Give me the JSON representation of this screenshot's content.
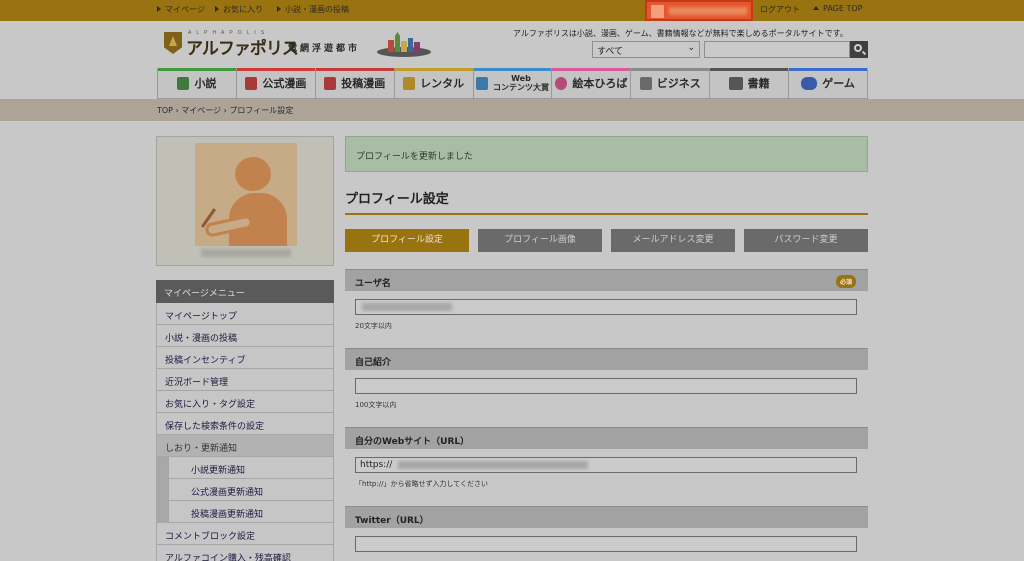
{
  "topbar": {
    "links": [
      "マイページ",
      "お気に入り",
      "小説・漫画の投稿"
    ],
    "logout": "ログアウト",
    "pagetop": "PAGE TOP"
  },
  "header": {
    "logo_sub": "ALPHAPOLIS",
    "logo_main": "アルファポリス",
    "logo_city": "電網浮遊都市",
    "tagline": "アルファポリスは小説、漫画、ゲーム、書籍情報などが無料で楽しめるポータルサイトです。",
    "search_scope": "すべて"
  },
  "nav": [
    {
      "label": "小説",
      "color": "#3d9a3d"
    },
    {
      "label": "公式漫画",
      "color": "#d03a3a"
    },
    {
      "label": "投稿漫画",
      "color": "#c83a3a"
    },
    {
      "label": "レンタル",
      "color": "#c29b2a"
    },
    {
      "label_line1": "Web",
      "label_line2": "コンテンツ大賞",
      "color": "#3a8ccc"
    },
    {
      "label": "絵本ひろば",
      "color": "#d85a9a"
    },
    {
      "label": "ビジネス",
      "color": "#8a8a8a"
    },
    {
      "label": "書籍",
      "color": "#555555"
    },
    {
      "label": "ゲーム",
      "color": "#3a6ccc"
    }
  ],
  "breadcrumb": "TOP › マイページ › プロフィール設定",
  "sidebar": {
    "menu_title": "マイページメニュー",
    "items": [
      "マイページトップ",
      "小説・漫画の投稿",
      "投稿インセンティブ",
      "近況ボード管理",
      "お気に入り・タグ設定",
      "保存した検索条件の設定"
    ],
    "group_label": "しおり・更新通知",
    "sub_items": [
      "小説更新通知",
      "公式漫画更新通知",
      "投稿漫画更新通知"
    ],
    "items_after": [
      "コメントブロック設定",
      "アルファコイン購入・残高確認"
    ]
  },
  "main": {
    "notice": "プロフィールを更新しました",
    "title": "プロフィール設定",
    "tabs": [
      "プロフィール設定",
      "プロフィール画像",
      "メールアドレス変更",
      "パスワード変更"
    ],
    "username_label": "ユーザ名",
    "required_badge": "必須",
    "username_hint": "20文字以内",
    "bio_label": "自己紹介",
    "bio_hint": "100文字以内",
    "website_label": "自分のWebサイト（URL）",
    "website_value": "https://",
    "website_hint": "「http://」から省略せず入力してください",
    "twitter_label": "Twitter（URL）"
  }
}
